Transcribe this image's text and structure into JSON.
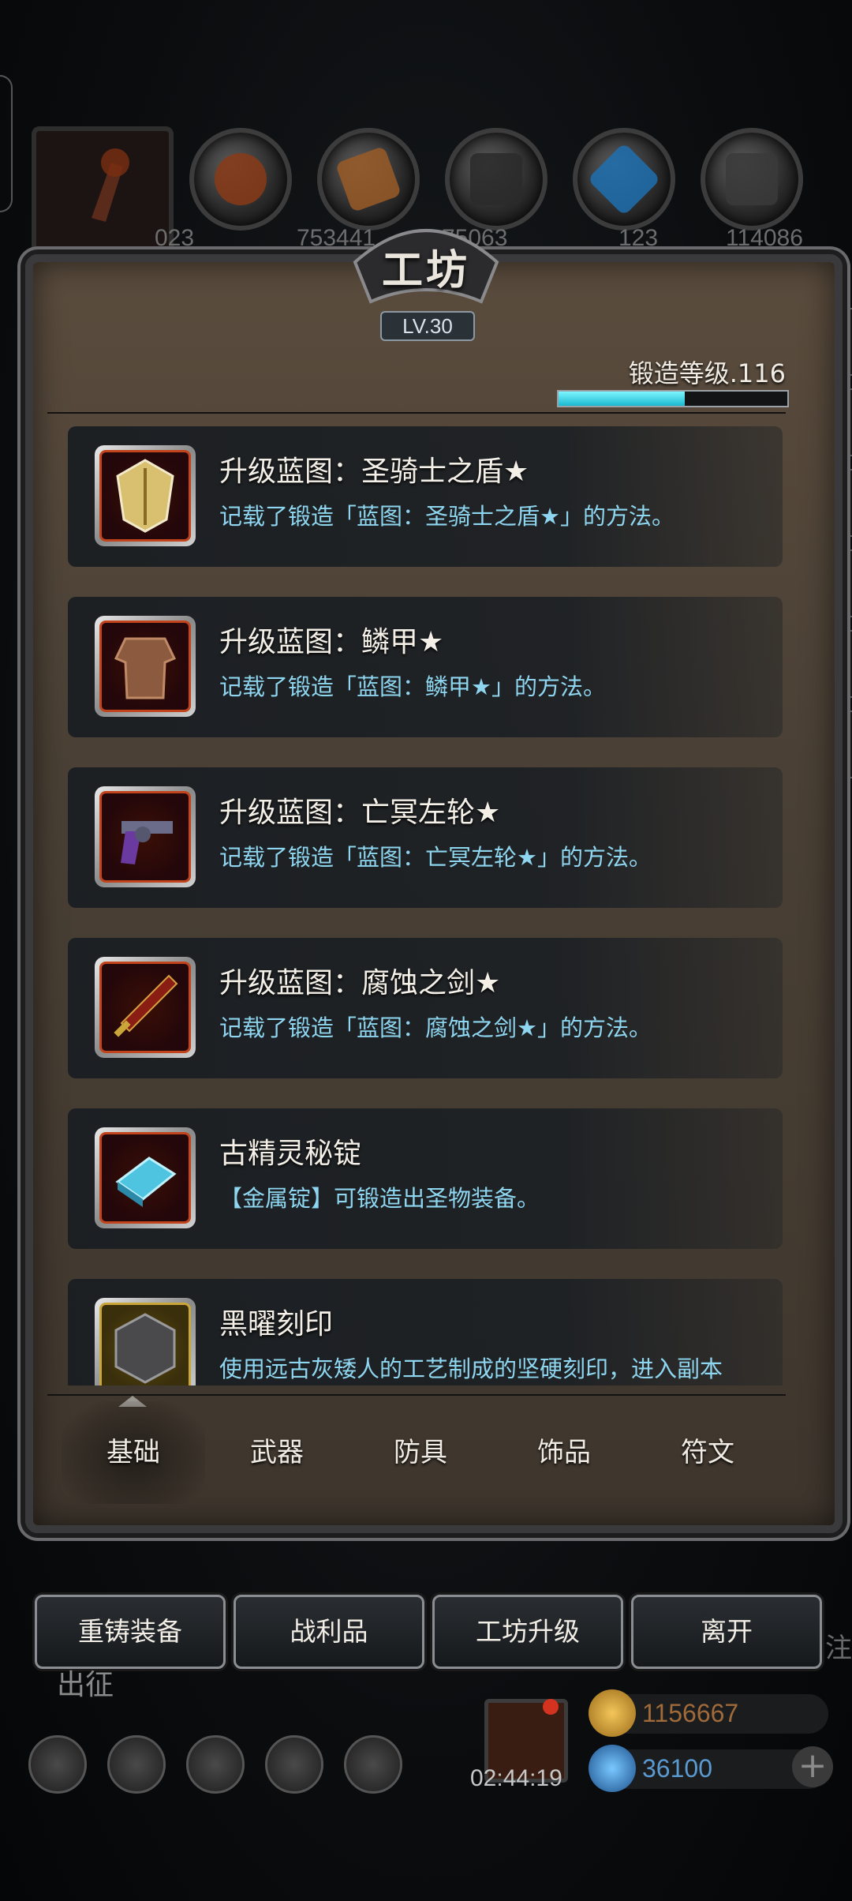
{
  "window": {
    "title": "工坊",
    "level_badge": "LV.30"
  },
  "forge": {
    "label": "锻造等级.116",
    "progress": 0.55
  },
  "resources": {
    "numbers": [
      "023",
      "753441",
      "75063",
      "123",
      "114086"
    ]
  },
  "items": [
    {
      "name": "升级蓝图：圣骑士之盾★",
      "desc": "记载了锻造「蓝图：圣骑士之盾★」的方法。",
      "icon": "holy-knight-shield-icon",
      "frame": "red"
    },
    {
      "name": "升级蓝图：鳞甲★",
      "desc": "记载了锻造「蓝图：鳞甲★」的方法。",
      "icon": "scale-armor-icon",
      "frame": "red"
    },
    {
      "name": "升级蓝图：亡冥左轮★",
      "desc": "记载了锻造「蓝图：亡冥左轮★」的方法。",
      "icon": "revolver-icon",
      "frame": "red"
    },
    {
      "name": "升级蓝图：腐蚀之剑★",
      "desc": "记载了锻造「蓝图：腐蚀之剑★」的方法。",
      "icon": "corrosion-sword-icon",
      "frame": "red"
    },
    {
      "name": "古精灵秘锭",
      "desc": "【金属锭】可锻造出圣物装备。",
      "icon": "elf-ingot-icon",
      "frame": "red"
    },
    {
      "name": "黑曜刻印",
      "desc": "使用远古灰矮人的工艺制成的坚硬刻印，进入副本「灰岩圣窟」的钥匙",
      "icon": "obsidian-seal-icon",
      "frame": "gold"
    }
  ],
  "tabs": [
    "基础",
    "武器",
    "防具",
    "饰品",
    "符文"
  ],
  "active_tab": "基础",
  "buttons": [
    "重铸装备",
    "战利品",
    "工坊升级",
    "离开"
  ],
  "footer": {
    "sortie": "出征",
    "edge_text": "注",
    "timer": "02:44:19",
    "gold": "1156667",
    "gems": "36100",
    "plus": "+"
  },
  "colors": {
    "accent_cyan": "#1bb8cf",
    "desc_blue": "#8ed6f0",
    "frame_red": "#c2441d",
    "frame_gold": "#c9a53a"
  }
}
